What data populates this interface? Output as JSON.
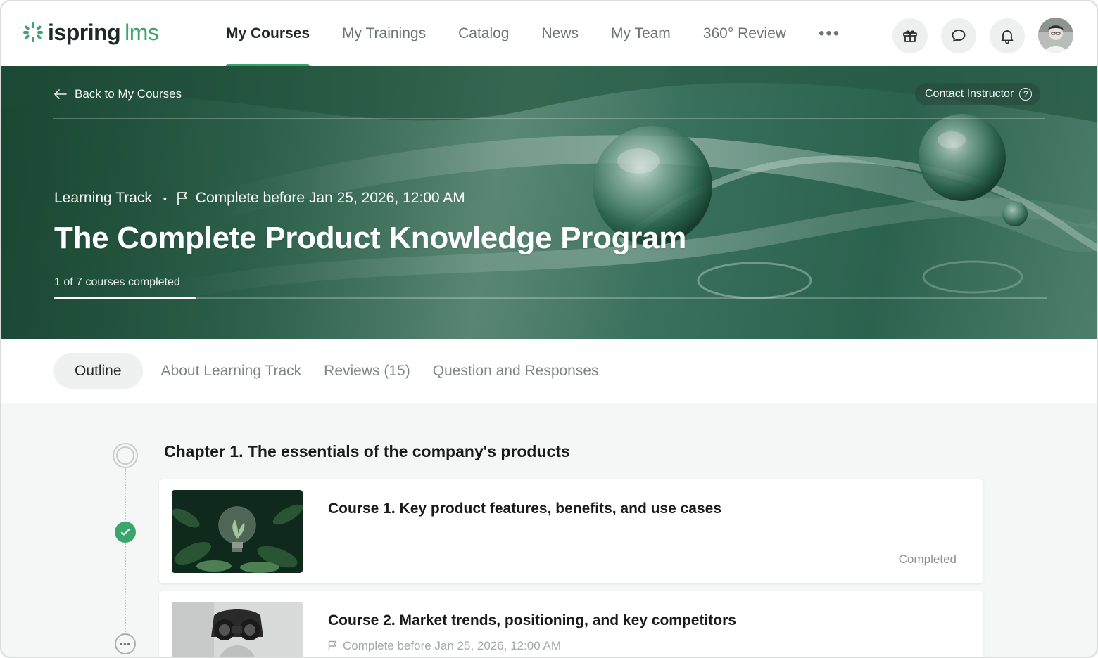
{
  "header": {
    "logo_text": "ispring",
    "logo_suffix": "lms",
    "nav": [
      {
        "label": "My Courses",
        "active": true
      },
      {
        "label": "My Trainings"
      },
      {
        "label": "Catalog"
      },
      {
        "label": "News"
      },
      {
        "label": "My Team"
      },
      {
        "label": "360° Review"
      }
    ],
    "more_label": "•••",
    "icons": [
      "gift-icon",
      "chat-icon",
      "bell-icon",
      "user-avatar"
    ]
  },
  "hero": {
    "back_label": "Back to My Courses",
    "contact_label": "Contact Instructor",
    "contact_help": "?",
    "type_label": "Learning Track",
    "separator": "•",
    "due_label": "Complete before Jan 25, 2026, 12:00 AM",
    "title": "The Complete Product Knowledge Program",
    "progress_label": "1 of 7 courses completed",
    "progress": {
      "completed": 1,
      "total": 7
    }
  },
  "tabs": [
    {
      "label": "Outline",
      "active": true
    },
    {
      "label": "About Learning Track"
    },
    {
      "label": "Reviews (15)"
    },
    {
      "label": "Question and Responses"
    }
  ],
  "outline": {
    "chapter_title": "Chapter 1. The essentials of the company's products",
    "courses": [
      {
        "title": "Course 1. Key product features, benefits, and use cases",
        "status": "Completed"
      },
      {
        "title": "Course 2. Market trends, positioning, and key competitors",
        "due": "Complete before Jan 25, 2026, 12:00 AM"
      }
    ]
  },
  "colors": {
    "accent": "#3aa66e",
    "hero_dark": "#23583f",
    "muted": "#7f8785"
  }
}
